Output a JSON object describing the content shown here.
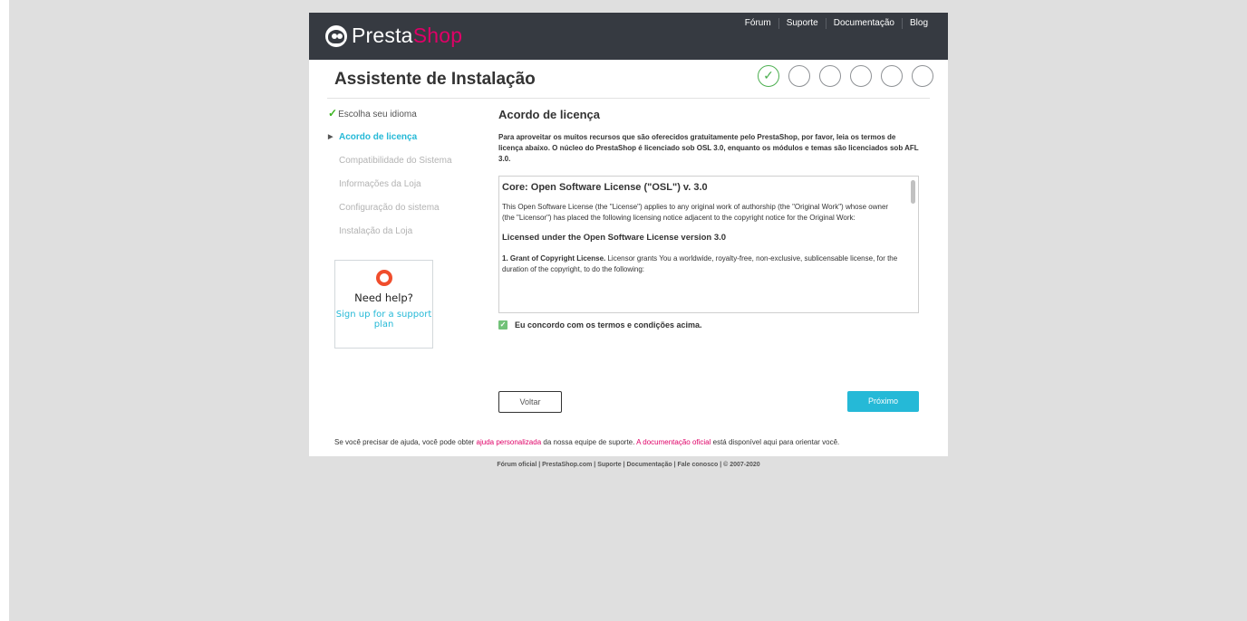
{
  "brand": {
    "name_part1": "Presta",
    "name_part2": "Shop"
  },
  "topnav": [
    "Fórum",
    "Suporte",
    "Documentação",
    "Blog"
  ],
  "page_title": "Assistente de Instalação",
  "steps": {
    "total": 6,
    "completed": 1
  },
  "sidebar": {
    "items": [
      {
        "label": "Escolha seu idioma",
        "state": "done"
      },
      {
        "label": "Acordo de licença",
        "state": "active"
      },
      {
        "label": "Compatibilidade do Sistema",
        "state": "pending"
      },
      {
        "label": "Informações da Loja",
        "state": "pending"
      },
      {
        "label": "Configuração do sistema",
        "state": "pending"
      },
      {
        "label": "Instalação da Loja",
        "state": "pending"
      }
    ]
  },
  "help_box": {
    "title": "Need help?",
    "link": "Sign up for a support plan"
  },
  "content": {
    "heading": "Acordo de licença",
    "intro": "Para aproveitar os muitos recursos que são oferecidos gratuitamente pelo PrestaShop, por favor, leia os termos de licença abaixo. O núcleo do PrestaShop é licenciado sob OSL 3.0, enquanto os módulos e temas são licenciados sob AFL 3.0.",
    "license": {
      "title": "Core: Open Software License (\"OSL\") v. 3.0",
      "para1": "This Open Software License (the \"License\") applies to any original work of authorship (the \"Original Work\") whose owner (the \"Licensor\") has placed the following licensing notice adjacent to the copyright notice for the Original Work:",
      "subtitle": "Licensed under the Open Software License version 3.0",
      "grant_bold": "1. Grant of Copyright License.",
      "grant_text": " Licensor grants You a worldwide, royalty-free, non-exclusive, sublicensable license, for the duration of the copyright, to do the following:"
    },
    "agree_label": "Eu concordo com os termos e condições acima."
  },
  "buttons": {
    "back": "Voltar",
    "next": "Próximo"
  },
  "footer_help": {
    "part1": "Se você precisar de ajuda, você pode obter ",
    "link1": "ajuda personalizada",
    "part2": " da nossa equipe de suporte. ",
    "link2": "A documentação oficial",
    "part3": " está disponível aqui para orientar você."
  },
  "footer_links": "Fórum oficial | PrestaShop.com | Suporte | Documentação | Fale conosco | © 2007-2020",
  "colors": {
    "accent": "#25b9d7",
    "brand_pink": "#df0067",
    "header_bg": "#363a41",
    "success": "#4caf50"
  }
}
